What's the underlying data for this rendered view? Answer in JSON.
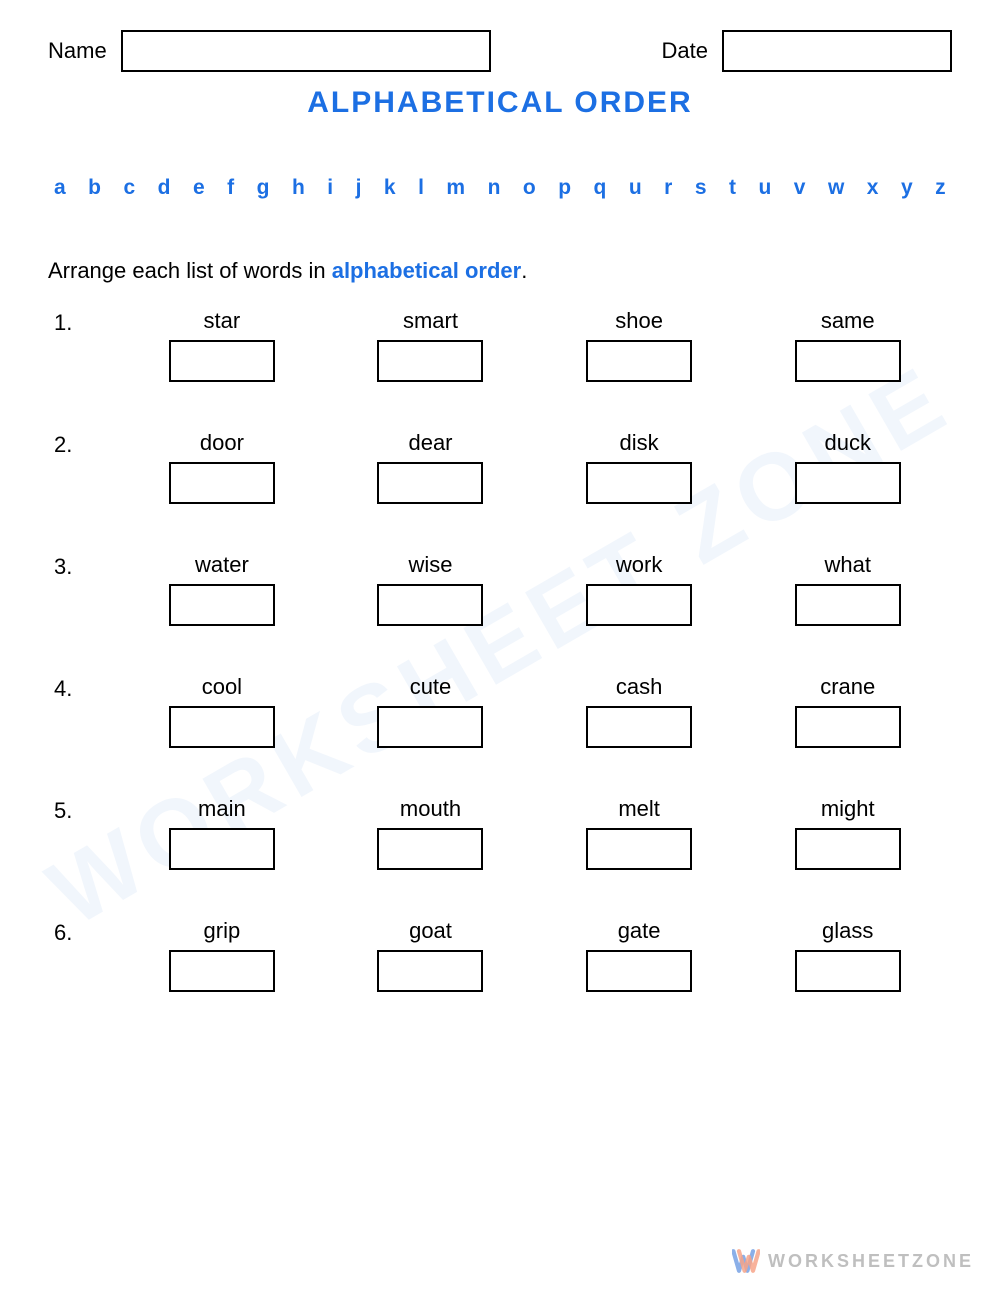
{
  "header": {
    "name_label": "Name",
    "date_label": "Date"
  },
  "title": "ALPHABETICAL ORDER",
  "alphabet": [
    "a",
    "b",
    "c",
    "d",
    "e",
    "f",
    "g",
    "h",
    "i",
    "j",
    "k",
    "l",
    "m",
    "n",
    "o",
    "p",
    "q",
    "u",
    "r",
    "s",
    "t",
    "u",
    "v",
    "w",
    "x",
    "y",
    "z"
  ],
  "instruction_prefix": "Arrange each list of words in ",
  "instruction_accent": "alphabetical order",
  "instruction_suffix": ".",
  "rows": [
    {
      "num": "1.",
      "words": [
        "star",
        "smart",
        "shoe",
        "same"
      ]
    },
    {
      "num": "2.",
      "words": [
        "door",
        "dear",
        "disk",
        "duck"
      ]
    },
    {
      "num": "3.",
      "words": [
        "water",
        "wise",
        "work",
        "what"
      ]
    },
    {
      "num": "4.",
      "words": [
        "cool",
        "cute",
        "cash",
        "crane"
      ]
    },
    {
      "num": "5.",
      "words": [
        "main",
        "mouth",
        "melt",
        "might"
      ]
    },
    {
      "num": "6.",
      "words": [
        "grip",
        "goat",
        "gate",
        "glass"
      ]
    }
  ],
  "watermark": {
    "brand": "WORKSHEETZONE",
    "diagonal": "WORKSHEET ZONE"
  }
}
